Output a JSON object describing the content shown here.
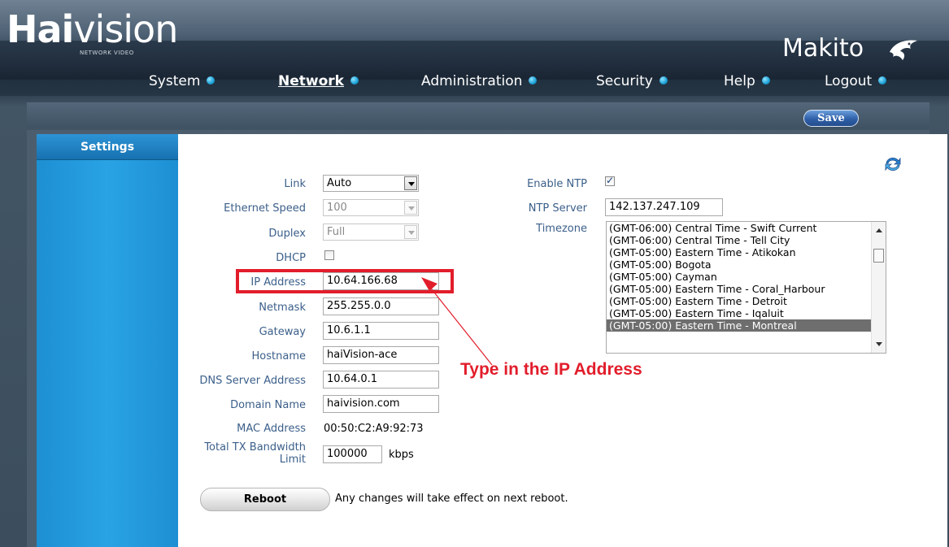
{
  "brand": {
    "logo_part1": "Hai",
    "logo_part2": "vision",
    "logo_sub": "NETWORK VIDEO",
    "product": "Makito",
    "product_icon": "shark-icon"
  },
  "nav": {
    "items": [
      {
        "label": "System",
        "active": false
      },
      {
        "label": "Network",
        "active": true
      },
      {
        "label": "Administration",
        "active": false
      },
      {
        "label": "Security",
        "active": false
      },
      {
        "label": "Help",
        "active": false
      },
      {
        "label": "Logout",
        "active": false
      }
    ]
  },
  "toolbar": {
    "save_label": "Save"
  },
  "sidebar": {
    "tab_label": "Settings"
  },
  "form": {
    "link": {
      "label": "Link",
      "value": "Auto"
    },
    "ethernet_speed": {
      "label": "Ethernet Speed",
      "value": "100"
    },
    "duplex": {
      "label": "Duplex",
      "value": "Full"
    },
    "dhcp": {
      "label": "DHCP",
      "checked": false
    },
    "ip_address": {
      "label": "IP Address",
      "value": "10.64.166.68"
    },
    "netmask": {
      "label": "Netmask",
      "value": "255.255.0.0"
    },
    "gateway": {
      "label": "Gateway",
      "value": "10.6.1.1"
    },
    "hostname": {
      "label": "Hostname",
      "value": "haiVision-ace"
    },
    "dns_server": {
      "label": "DNS Server Address",
      "value": "10.64.0.1"
    },
    "domain_name": {
      "label": "Domain Name",
      "value": "haivision.com"
    },
    "mac_address": {
      "label": "MAC Address",
      "value": "00:50:C2:A9:92:73"
    },
    "bandwidth": {
      "label_line1": "Total TX Bandwidth",
      "label_line2": "Limit",
      "value": "100000",
      "unit": "kbps"
    },
    "enable_ntp": {
      "label": "Enable NTP",
      "checked": true
    },
    "ntp_server": {
      "label": "NTP Server",
      "value": "142.137.247.109"
    },
    "timezone": {
      "label": "Timezone",
      "options": [
        "(GMT-06:00) Central Time - Swift Current",
        "(GMT-06:00) Central Time - Tell City",
        "(GMT-05:00) Eastern Time - Atikokan",
        "(GMT-05:00) Bogota",
        "(GMT-05:00) Cayman",
        "(GMT-05:00) Eastern Time - Coral_Harbour",
        "(GMT-05:00) Eastern Time - Detroit",
        "(GMT-05:00) Eastern Time - Iqaluit",
        "(GMT-05:00) Eastern Time - Montreal"
      ],
      "selected": "(GMT-05:00) Eastern Time - Montreal"
    }
  },
  "reboot": {
    "button_label": "Reboot",
    "message": "Any changes will take effect on next reboot."
  },
  "annotation": {
    "text": "Type in the IP Address",
    "color": "#e21d2b"
  },
  "colors": {
    "label": "#3b5f8a",
    "sidebar": "#1d8fd2",
    "nav_dot": "#1a9fd6",
    "save_button": "#2e5fa8"
  }
}
